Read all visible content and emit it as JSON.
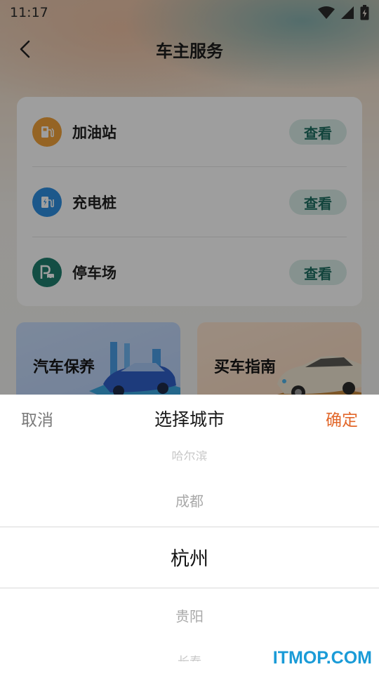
{
  "status_bar": {
    "time": "11:17",
    "icons": [
      "wifi-icon",
      "signal-icon",
      "battery-charging-icon"
    ]
  },
  "navbar": {
    "back_icon": "chevron-left-icon",
    "title": "车主服务"
  },
  "services": [
    {
      "name": "加油站",
      "icon": "gas-station-icon",
      "icon_color": "#f0a23a",
      "action": "查看"
    },
    {
      "name": "充电桩",
      "icon": "charging-pile-icon",
      "icon_color": "#2e8fe0",
      "action": "查看"
    },
    {
      "name": "停车场",
      "icon": "parking-icon",
      "icon_color": "#1f7e6e",
      "action": "查看"
    }
  ],
  "promos": [
    {
      "title": "汽车保养"
    },
    {
      "title": "买车指南"
    }
  ],
  "city_picker": {
    "cancel": "取消",
    "title": "选择城市",
    "confirm": "确定",
    "options": [
      "哈尔滨",
      "成都",
      "杭州",
      "贵阳",
      "长春"
    ],
    "selected": "杭州"
  },
  "colors": {
    "accent_confirm": "#e2672a",
    "view_button_text": "#1e6e62",
    "view_button_bg": "#d9ece7"
  },
  "watermark": "ITMOP.COM"
}
